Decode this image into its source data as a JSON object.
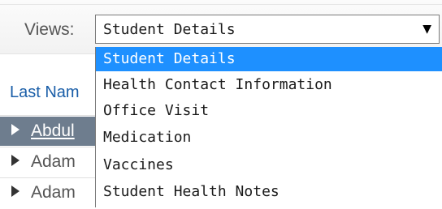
{
  "toolbar": {
    "views_label": "Views:",
    "views_select": {
      "value": "Student Details",
      "arrow_icon": "triangle-down-icon",
      "options": [
        {
          "label": "Student Details",
          "selected": true
        },
        {
          "label": "Health Contact Information",
          "selected": false
        },
        {
          "label": "Office Visit",
          "selected": false
        },
        {
          "label": "Medication",
          "selected": false
        },
        {
          "label": "Vaccines",
          "selected": false
        },
        {
          "label": "Student Health Notes",
          "selected": false
        }
      ]
    }
  },
  "table": {
    "column_header": "Last Nam",
    "rows": [
      {
        "name": "Abdul",
        "selected": true
      },
      {
        "name": "Adam",
        "selected": false
      },
      {
        "name": "Adam",
        "selected": false
      }
    ]
  },
  "colors": {
    "selected_option": "#1e90ff",
    "selected_row": "#6e7d8e",
    "link": "#1a5ea8"
  }
}
